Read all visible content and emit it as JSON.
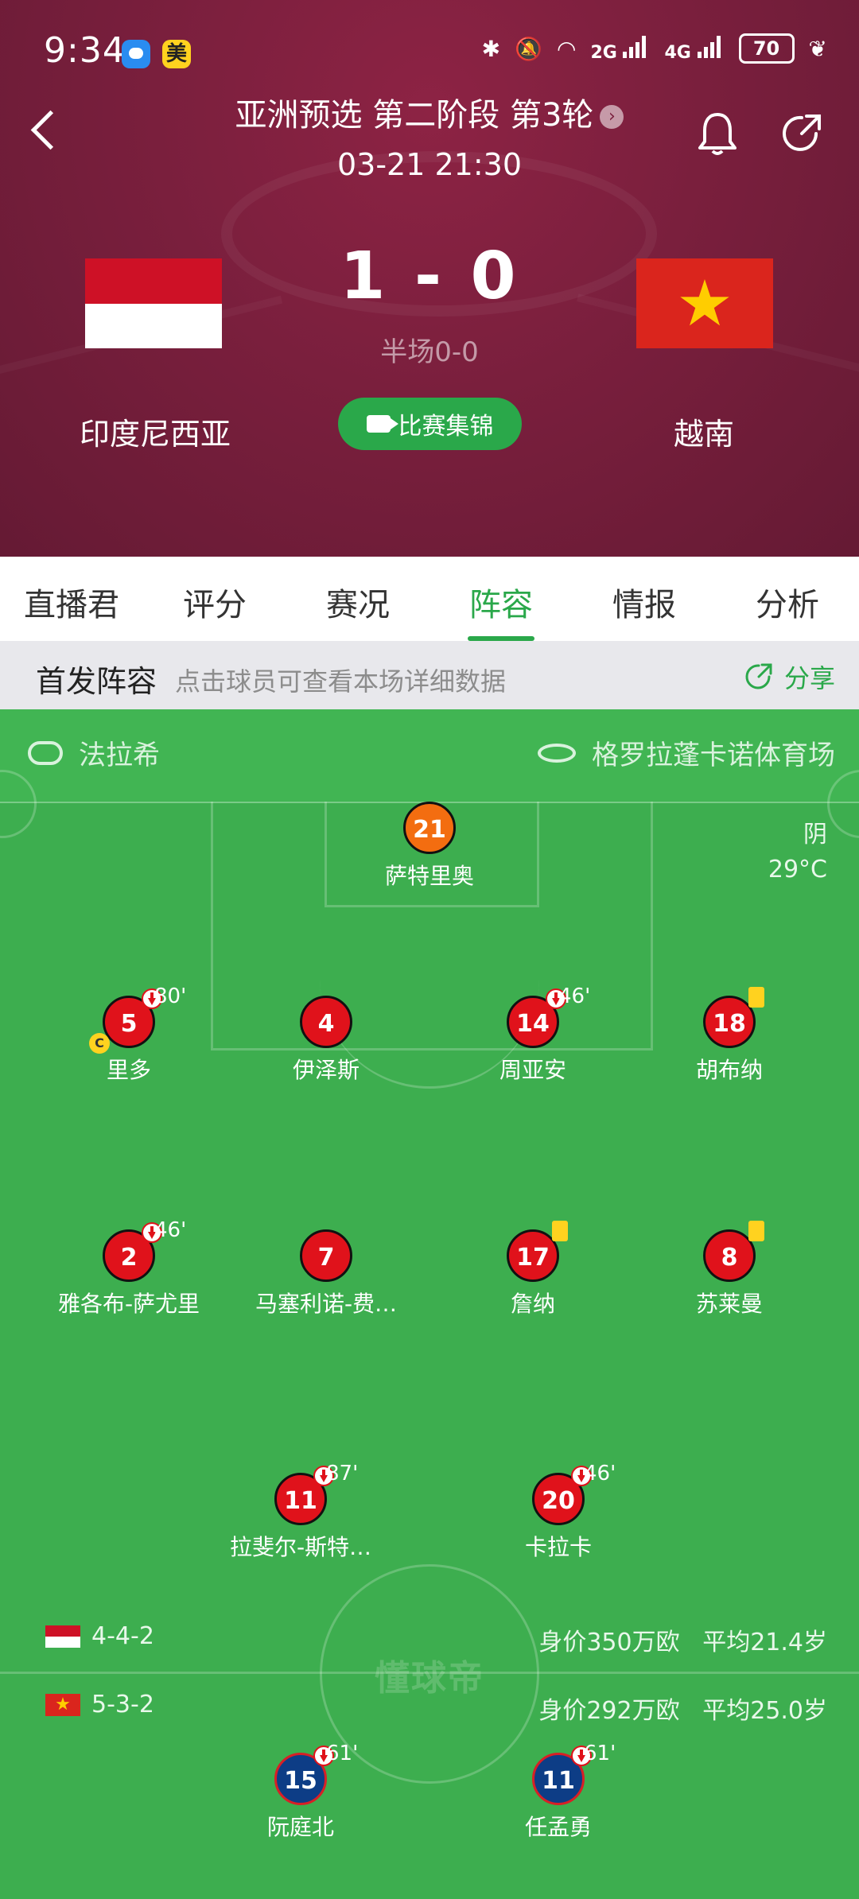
{
  "status_bar": {
    "time": "9:34",
    "app_badge": "美",
    "net1": "2G",
    "net2": "4G",
    "battery": "70"
  },
  "header": {
    "competition": "亚洲预选 第二阶段 第3轮",
    "datetime": "03-21 21:30",
    "score": "1 - 0",
    "halftime": "半场0-0",
    "home_team": "印度尼西亚",
    "away_team": "越南",
    "highlight_label": "比赛集锦"
  },
  "tabs": [
    {
      "label": "直播君"
    },
    {
      "label": "评分"
    },
    {
      "label": "赛况"
    },
    {
      "label": "阵容",
      "active": true
    },
    {
      "label": "情报"
    },
    {
      "label": "分析"
    }
  ],
  "lineup_bar": {
    "title": "首发阵容",
    "hint": "点击球员可查看本场详细数据",
    "share": "分享"
  },
  "match_info": {
    "referee": "法拉希",
    "stadium": "格罗拉蓬卡诺体育场",
    "weather": "阴",
    "temperature": "29°C"
  },
  "home_players": [
    {
      "number": "21",
      "name": "萨特里奥",
      "color": "orange"
    },
    {
      "number": "5",
      "name": "里多",
      "sub": "80'",
      "captain": "C"
    },
    {
      "number": "4",
      "name": "伊泽斯"
    },
    {
      "number": "14",
      "name": "周亚安",
      "sub": "46'"
    },
    {
      "number": "18",
      "name": "胡布纳",
      "yellow": true
    },
    {
      "number": "2",
      "name": "雅各布-萨尤里",
      "sub": "46'"
    },
    {
      "number": "7",
      "name": "马塞利诺-费…"
    },
    {
      "number": "17",
      "name": "詹纳",
      "yellow": true
    },
    {
      "number": "8",
      "name": "苏莱曼",
      "yellow": true
    },
    {
      "number": "11",
      "name": "拉斐尔-斯特…",
      "sub": "87'"
    },
    {
      "number": "20",
      "name": "卡拉卡",
      "sub": "46'"
    }
  ],
  "away_players": [
    {
      "number": "15",
      "name": "阮庭北",
      "sub": "61'"
    },
    {
      "number": "11",
      "name": "任孟勇",
      "sub": "61'"
    }
  ],
  "formations": {
    "home": {
      "formation": "4-4-2",
      "value": "身价350万欧",
      "age": "平均21.4岁"
    },
    "away": {
      "formation": "5-3-2",
      "value": "身价292万欧",
      "age": "平均25.0岁"
    }
  },
  "watermark": "懂球帝",
  "colors": {
    "header": "#7a1f3d",
    "accent": "#2aa84a",
    "pitch": "#3dae4f",
    "home_kit": "#e0121b",
    "keeper": "#f36d10",
    "away_kit": "#0d3d86"
  }
}
